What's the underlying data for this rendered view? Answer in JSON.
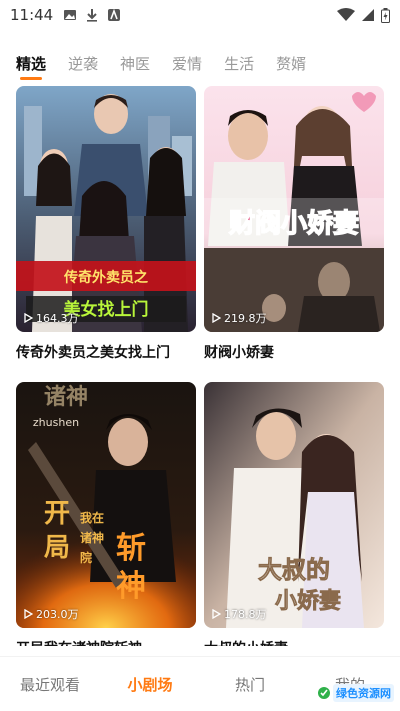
{
  "status_bar": {
    "time": "11:44"
  },
  "tabs": [
    {
      "label": "精选",
      "active": true
    },
    {
      "label": "逆袭",
      "active": false
    },
    {
      "label": "神医",
      "active": false
    },
    {
      "label": "爱情",
      "active": false
    },
    {
      "label": "生活",
      "active": false
    },
    {
      "label": "赘婿",
      "active": false
    }
  ],
  "dramas": [
    {
      "title": "传奇外卖员之美女找上门",
      "views": "164.3万",
      "poster_text": "传奇外卖员之美女找上门"
    },
    {
      "title": "财阀小娇妻",
      "views": "219.8万",
      "poster_text": "财阀小娇妻"
    },
    {
      "title": "开局我在诸神院斩神",
      "views": "203.0万",
      "poster_text": "开局我在诸神院斩神",
      "poster_subtitle": "zhushen"
    },
    {
      "title": "大叔的小娇妻",
      "views": "178.8万",
      "poster_text": "大叔的小娇妻"
    }
  ],
  "bottom_nav": [
    {
      "label": "最近观看",
      "active": false
    },
    {
      "label": "小剧场",
      "active": true
    },
    {
      "label": "热门",
      "active": false
    },
    {
      "label": "我的",
      "active": false
    }
  ],
  "watermark": {
    "text": "绿色资源网"
  },
  "colors": {
    "accent": "#ff7a12",
    "inactive_tab": "#9a9a9a"
  }
}
